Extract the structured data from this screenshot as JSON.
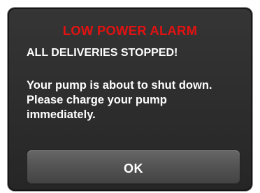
{
  "alarm": {
    "title": "LOW POWER ALARM",
    "headline": "ALL DELIVERIES STOPPED!",
    "message_lines": [
      "Your pump is about to shut down.",
      "Please charge your pump",
      "immediately."
    ],
    "ok_label": "OK"
  },
  "colors": {
    "alarm_title": "#e01212",
    "text": "#ffffff",
    "screen_background": "#2f2f2f",
    "button_background": "#555555"
  }
}
